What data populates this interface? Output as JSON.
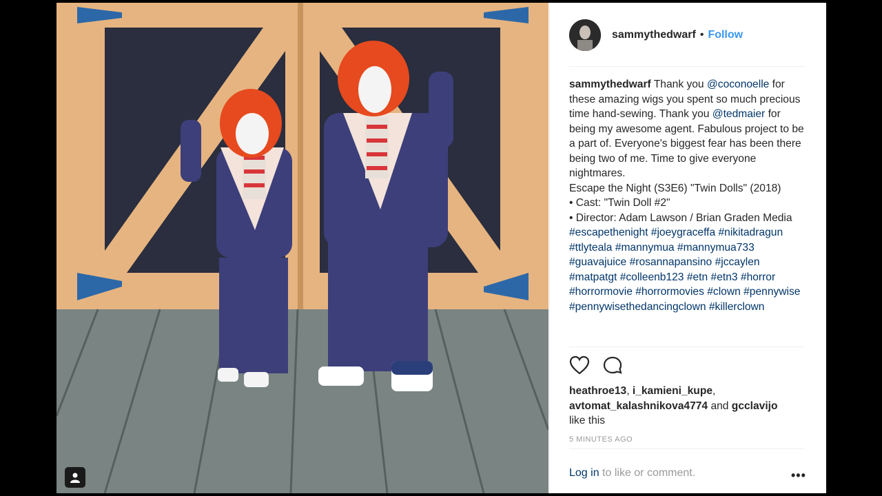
{
  "post": {
    "username": "sammythedwarf",
    "dot": "•",
    "follow_label": "Follow",
    "caption_parts": {
      "username": "sammythedwarf",
      "t1": " Thank you ",
      "m1": "@coconoelle",
      "t2": " for these amazing wigs you spent so much precious time hand-sewing. Thank you ",
      "m2": "@tedmaier",
      "t3": " for being my awesome agent. Fabulous project to be a part of. Everyone's biggest fear has been there being two of me. Time to give everyone nightmares.",
      "line1": "Escape the Night (S3E6) \"Twin Dolls\" (2018)",
      "line2": "• Cast: \"Twin Doll #2\"",
      "line3": "• Director: Adam Lawson / Brian Graden Media"
    },
    "hashtags": [
      "#escapethenight",
      "#joeygraceffa",
      "#nikitadragun",
      "#ttlyteala",
      "#mannymua",
      "#mannymua733",
      "#guavajuice",
      "#rosannapansino",
      "#jccaylen",
      "#matpatgt",
      "#colleenb123",
      "#etn",
      "#etn3",
      "#horror",
      "#horrormovie",
      "#horrormovies",
      "#clown",
      "#pennywise",
      "#pennywisethedancingclown",
      "#killerclown"
    ],
    "likes": {
      "user1": "heathroe13",
      "sep1": ", ",
      "user2": "i_kamieni_kupe",
      "sep2": ", ",
      "user3": "avtomat_kalashnikova4774",
      "and": " and ",
      "user4": "gcclavijo",
      "suffix": "like this"
    },
    "timestamp": "5 MINUTES AGO",
    "login_link": "Log in",
    "login_suffix": " to like or comment.",
    "more": "•••"
  },
  "icons": [
    "heart-icon",
    "comment-icon",
    "tag-people-icon",
    "more-options-icon"
  ]
}
